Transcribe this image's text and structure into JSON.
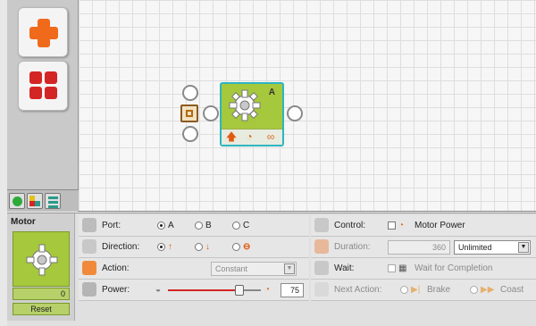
{
  "workspace": {
    "motor_block": {
      "port_letter": "A"
    }
  },
  "config": {
    "block_title": "Motor",
    "counter_value": "0",
    "reset_label": "Reset",
    "port": {
      "label": "Port:",
      "options": [
        "A",
        "B",
        "C"
      ],
      "selected": "A"
    },
    "direction": {
      "label": "Direction:"
    },
    "action": {
      "label": "Action:",
      "value": "Constant"
    },
    "power": {
      "label": "Power:",
      "value": "75",
      "level": 0.75
    },
    "control": {
      "label": "Control:",
      "option": "Motor Power"
    },
    "duration": {
      "label": "Duration:",
      "value": "360",
      "unit": "Unlimited"
    },
    "wait": {
      "label": "Wait:",
      "option": "Wait for Completion"
    },
    "next_action": {
      "label": "Next Action:",
      "options": [
        "Brake",
        "Coast"
      ]
    }
  },
  "colors": {
    "accent_green": "#a6c83c",
    "selection_cyan": "#2db5c0",
    "orange": "#f06a1c",
    "red": "#d42525"
  },
  "icons": [
    "plus-icon",
    "grid-icon",
    "gear-icon",
    "arrow-up-icon",
    "arrow-down-icon",
    "stop-icon",
    "motor-power-icon",
    "checkered-flag-icon"
  ]
}
